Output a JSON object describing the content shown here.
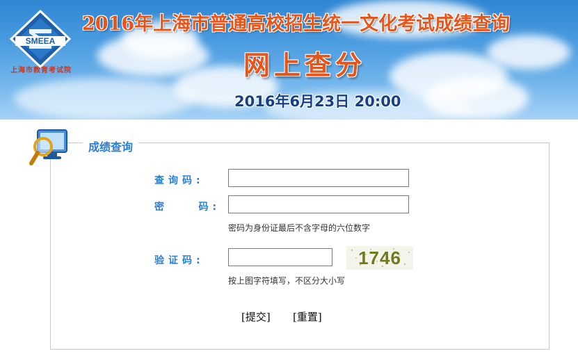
{
  "banner": {
    "title": "2016年上海市普通高校招生统一文化考试成绩查询",
    "subtitle": "网上查分",
    "date": "2016年6月23日   20:00",
    "org_name": "上海市教育考试院",
    "logo_text": "SMEEA"
  },
  "panel": {
    "title": "成绩查询",
    "fields": {
      "query_code": {
        "label": "查询码:",
        "value": ""
      },
      "password": {
        "label": "密    码:",
        "value": "",
        "hint": "密码为身份证最后不含字母的六位数字"
      },
      "captcha": {
        "label": "验证码:",
        "value": "",
        "image_text": "1746",
        "hint": "按上图字符填写，不区分大小写"
      }
    },
    "submit_label": "[提交]",
    "reset_label": "[重置]"
  },
  "colors": {
    "title_orange": "#e8541a",
    "label_blue": "#2a7fd4",
    "date_navy": "#1b3f86"
  }
}
